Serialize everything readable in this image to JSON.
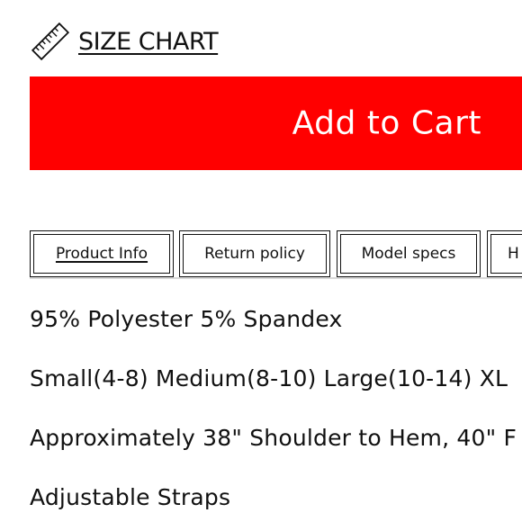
{
  "size_chart": {
    "icon": "ruler-icon",
    "label": "SIZE CHART"
  },
  "cart_button": {
    "label": "Add to Cart",
    "color": "#ff0000"
  },
  "tabs": [
    {
      "label": "Product Info",
      "active": true
    },
    {
      "label": "Return policy",
      "active": false
    },
    {
      "label": "Model specs",
      "active": false
    },
    {
      "label": "H",
      "active": false
    }
  ],
  "product_info": {
    "lines": [
      "95% Polyester 5% Spandex",
      "Small(4-8) Medium(8-10) Large(10-14) XL",
      "Approximately 38\" Shoulder to Hem, 40\" F",
      "Adjustable Straps"
    ]
  }
}
